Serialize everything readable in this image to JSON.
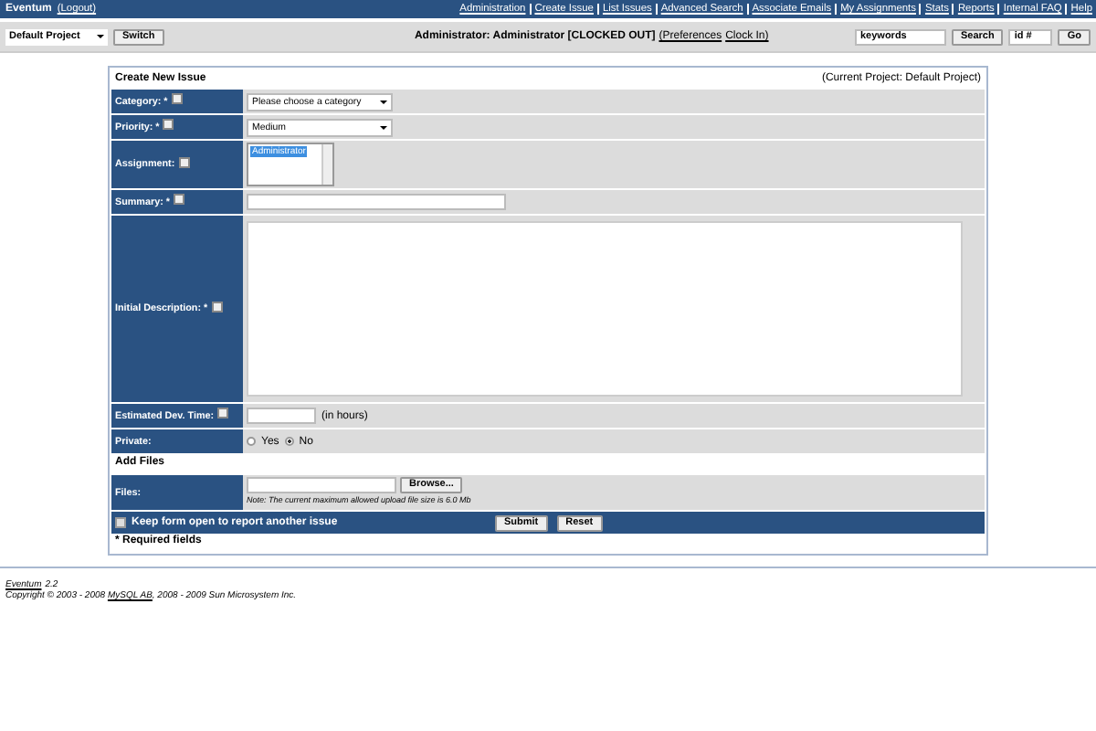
{
  "topbar": {
    "app_name": "Eventum",
    "logout": "(Logout)",
    "links": [
      "Administration",
      "Create Issue",
      "List Issues",
      "Advanced Search",
      "Associate Emails",
      "My Assignments",
      "Stats",
      "Reports",
      "Internal FAQ",
      "Help"
    ]
  },
  "toolbar": {
    "project": "Default Project",
    "switch_button": "Switch",
    "user_status": "Administrator: Administrator [CLOCKED OUT]",
    "user_links": [
      "(Preferences",
      "Clock In)"
    ],
    "search_value": "keywords",
    "search_button": "Search",
    "id_placeholder": "id #",
    "go_button": "Go"
  },
  "form": {
    "title": "Create New Issue",
    "current_project": "(Current Project: Default Project)",
    "rows": [
      {
        "kind": "select",
        "label": "Category: *",
        "help": true,
        "value": "Please choose a category"
      },
      {
        "kind": "select",
        "label": "Priority: *",
        "help": true,
        "value": "Medium"
      },
      {
        "kind": "listbox",
        "label": "Assignment:",
        "help": true,
        "options": [
          {
            "text": "Administrator",
            "selected": true
          }
        ]
      },
      {
        "kind": "text",
        "label": "Summary: *",
        "help": true
      },
      {
        "kind": "textarea",
        "label": "Initial Description: *",
        "help": true
      },
      {
        "kind": "hours",
        "label": "Estimated Dev. Time:",
        "help": true,
        "suffix": "(in hours)"
      },
      {
        "kind": "radio",
        "label": "Private:",
        "help": false,
        "options": [
          {
            "text": "Yes",
            "selected": false
          },
          {
            "text": "No",
            "selected": true
          }
        ]
      },
      {
        "kind": "section",
        "label": "Add Files"
      },
      {
        "kind": "file",
        "label": "Files:",
        "help": false,
        "button": "Browse...",
        "note": "Note: The current maximum allowed upload file size is 6.0 Mb"
      }
    ],
    "keep_open": {
      "label": "Keep form open to report another issue",
      "checked": false
    },
    "submit_button": "Submit",
    "reset_button": "Reset",
    "required_note": "* Required fields"
  },
  "footer": {
    "version_link": "Eventum",
    "version": "2.2",
    "copyright": "Copyright © 2003 - 2008 ",
    "mysql_link": "MySQL AB",
    "copyright_rest": ", 2008 - 2009 Sun Microsystem Inc."
  }
}
